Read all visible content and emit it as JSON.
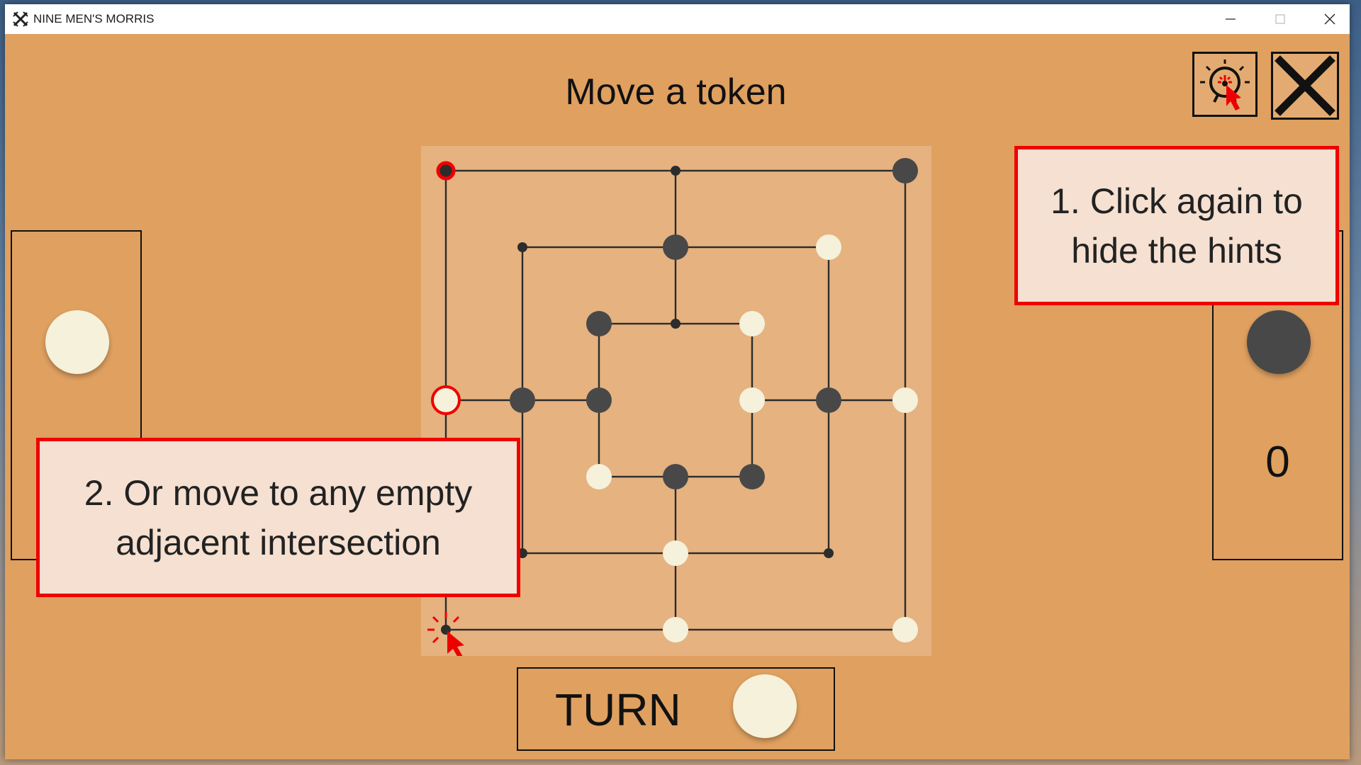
{
  "window": {
    "title": "NINE MEN'S MORRIS",
    "controls": [
      "minimize",
      "maximize",
      "close"
    ]
  },
  "header": {
    "message": "Move a token",
    "hint_button_icon": "lightbulb-icon",
    "exit_button_icon": "x-close-icon"
  },
  "players": {
    "white": {
      "token_color": "#f5f1db",
      "count": ""
    },
    "black": {
      "token_color": "#484848",
      "count": "0"
    }
  },
  "board": {
    "layout": "three-concentric-squares",
    "intersections": [
      {
        "pos": "outer-top-left",
        "state": "empty-highlight"
      },
      {
        "pos": "outer-top-middle",
        "state": "empty"
      },
      {
        "pos": "outer-top-right",
        "state": "black"
      },
      {
        "pos": "middle-top-left",
        "state": "empty"
      },
      {
        "pos": "middle-top-middle",
        "state": "black"
      },
      {
        "pos": "middle-top-right",
        "state": "white"
      },
      {
        "pos": "inner-top-left",
        "state": "black"
      },
      {
        "pos": "inner-top-middle",
        "state": "empty"
      },
      {
        "pos": "inner-top-right",
        "state": "white"
      },
      {
        "pos": "outer-middle-left",
        "state": "white-selected"
      },
      {
        "pos": "middle-middle-left",
        "state": "black"
      },
      {
        "pos": "inner-middle-left",
        "state": "black"
      },
      {
        "pos": "inner-middle-right",
        "state": "white"
      },
      {
        "pos": "middle-middle-right",
        "state": "black"
      },
      {
        "pos": "outer-middle-right",
        "state": "white"
      },
      {
        "pos": "inner-bottom-left",
        "state": "white"
      },
      {
        "pos": "inner-bottom-middle",
        "state": "black"
      },
      {
        "pos": "inner-bottom-right",
        "state": "black"
      },
      {
        "pos": "middle-bottom-left",
        "state": "empty"
      },
      {
        "pos": "middle-bottom-middle",
        "state": "white"
      },
      {
        "pos": "middle-bottom-right",
        "state": "empty"
      },
      {
        "pos": "outer-bottom-left",
        "state": "empty-hint"
      },
      {
        "pos": "outer-bottom-middle",
        "state": "white"
      },
      {
        "pos": "outer-bottom-right",
        "state": "white"
      }
    ]
  },
  "turn": {
    "label": "TURN",
    "current": "white"
  },
  "hints": {
    "callout_1": [
      "1. Click again to",
      "hide the hints"
    ],
    "callout_2": [
      "2. Or move to any empty",
      "adjacent intersection"
    ]
  },
  "colors": {
    "background": "#dfa060",
    "board": "#e5b280",
    "white_token": "#f5f1db",
    "black_token": "#484848",
    "highlight": "#ef0000",
    "callout_fill": "#f5e0d1"
  }
}
